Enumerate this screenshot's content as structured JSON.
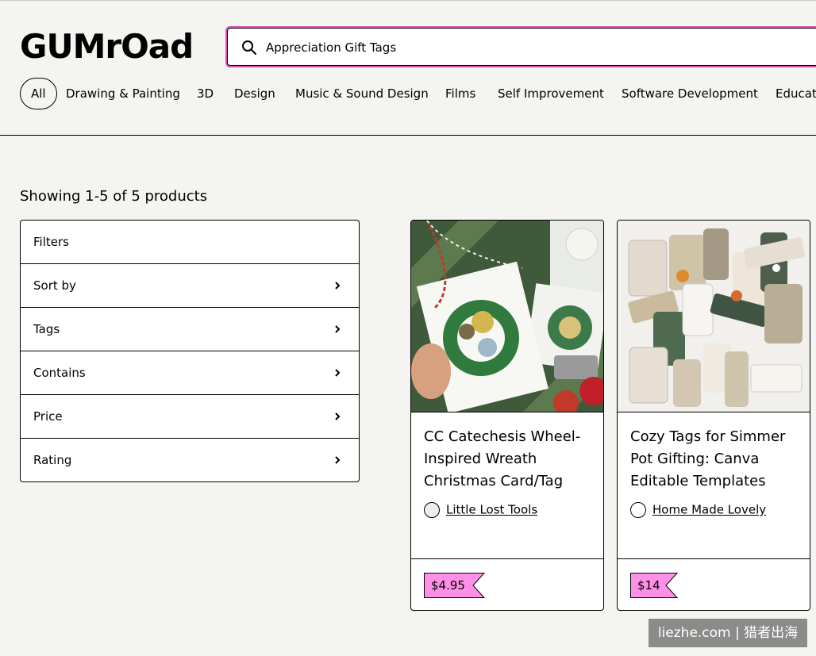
{
  "header": {
    "logo": "GUMrOad",
    "search": {
      "value": "Appreciation Gift Tags",
      "icon": "search-icon"
    },
    "nav": [
      {
        "label": "All",
        "active": true
      },
      {
        "label": "Drawing & Painting"
      },
      {
        "label": "3D"
      },
      {
        "label": "Design"
      },
      {
        "label": "Music & Sound Design"
      },
      {
        "label": "Films"
      },
      {
        "label": "Self Improvement"
      },
      {
        "label": "Software Development"
      },
      {
        "label": "Educat"
      }
    ]
  },
  "results": {
    "summary": "Showing 1-5 of 5 products"
  },
  "filters": [
    {
      "label": "Filters"
    },
    {
      "label": "Sort by",
      "icon": "chevron-right-icon"
    },
    {
      "label": "Tags",
      "icon": "chevron-right-icon"
    },
    {
      "label": "Contains",
      "icon": "chevron-right-icon"
    },
    {
      "label": "Price",
      "icon": "chevron-right-icon"
    },
    {
      "label": "Rating",
      "icon": "chevron-right-icon"
    }
  ],
  "products": [
    {
      "title": "CC Catechesis Wheel-Inspired Wreath Christmas Card/Tag",
      "creator": "Little Lost Tools",
      "price": "$4.95"
    },
    {
      "title": "Cozy Tags for Simmer Pot Gifting: Canva Editable Templates",
      "creator": "Home Made Lovely",
      "price": "$14"
    }
  ],
  "watermark": "liezhe.com | 猎者出海",
  "colors": {
    "accent": "#ff90e8",
    "focus_ring": "#e24fb8",
    "background": "#f4f4f0"
  }
}
